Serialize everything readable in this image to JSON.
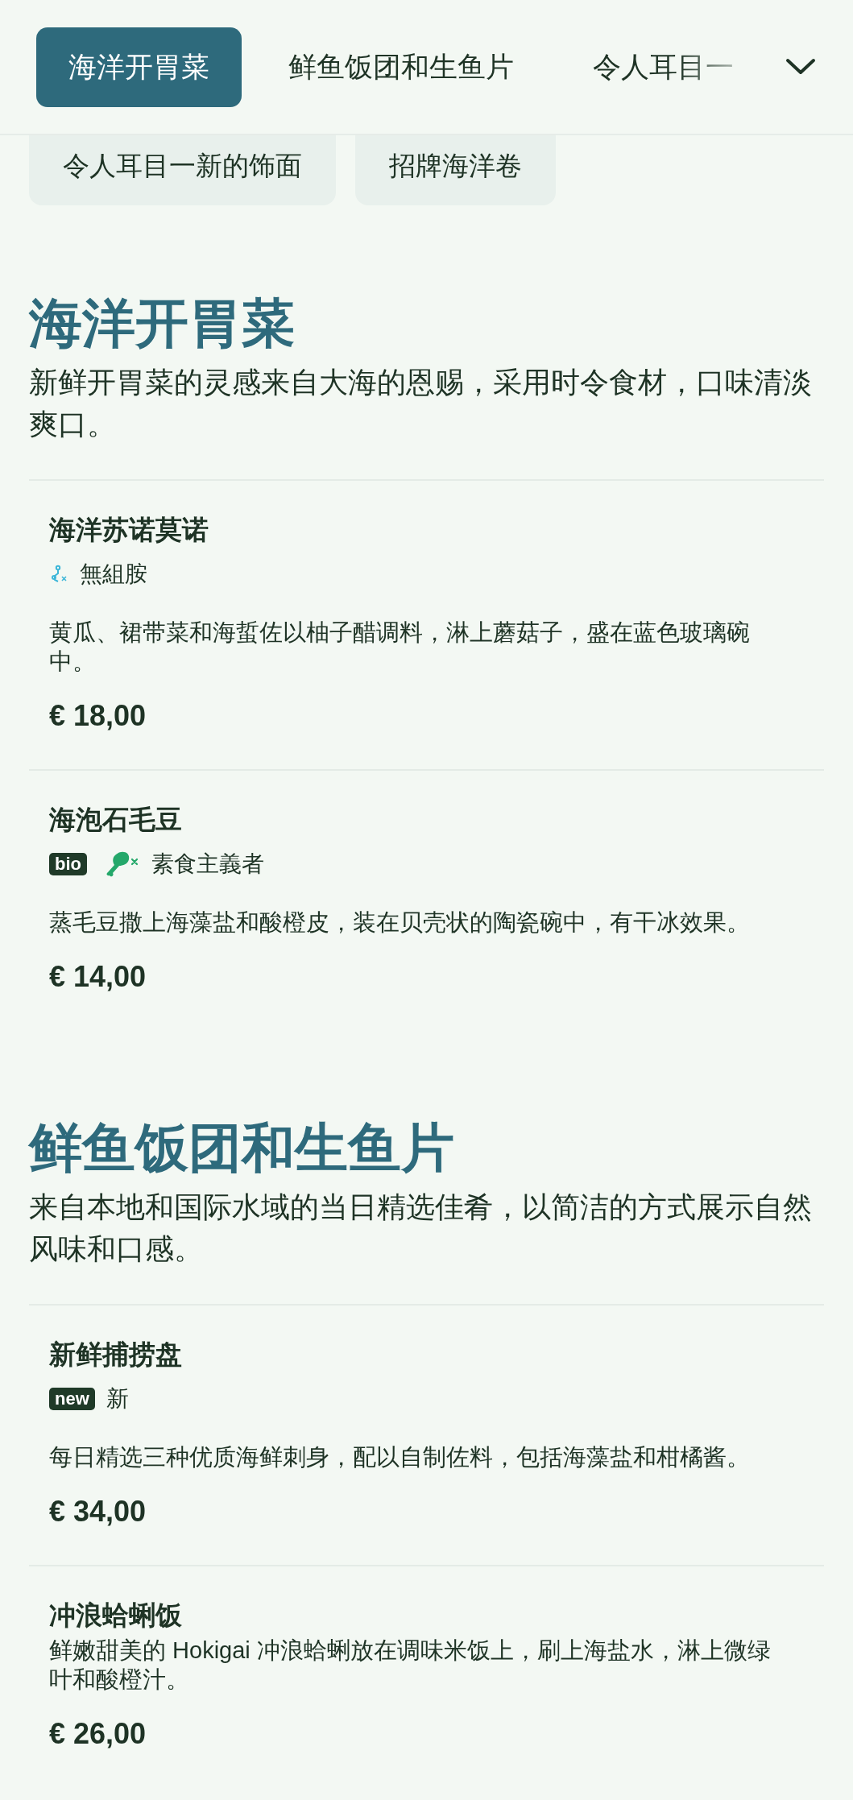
{
  "tabs": [
    {
      "label": "海洋开胃菜",
      "selected": true
    },
    {
      "label": "鲜鱼饭团和生鱼片",
      "selected": false
    },
    {
      "label": "令人耳目一",
      "selected": false
    }
  ],
  "category_chips": [
    "令人耳目一新的饰面",
    "招牌海洋卷"
  ],
  "sections": [
    {
      "title": "海洋开胃菜",
      "description": "新鲜开胃菜的灵感来自大海的恩赐，采用时令食材，口味清淡爽口。",
      "items": [
        {
          "name": "海洋苏诺莫诺",
          "tags": [
            {
              "kind": "histamine-free",
              "label": "無組胺"
            }
          ],
          "description": "黄瓜、裙带菜和海蜇佐以柚子醋调料，淋上蘑菇子，盛在蓝色玻璃碗中。",
          "price": "€ 18,00"
        },
        {
          "name": "海泡石毛豆",
          "tags": [
            {
              "kind": "badge",
              "label": "bio"
            },
            {
              "kind": "vegan",
              "label": "素食主義者"
            }
          ],
          "description": "蒸毛豆撒上海藻盐和酸橙皮，装在贝壳状的陶瓷碗中，有干冰效果。",
          "price": "€ 14,00"
        }
      ]
    },
    {
      "title": "鲜鱼饭团和生鱼片",
      "description": "来自本地和国际水域的当日精选佳肴，以简洁的方式展示自然风味和口感。",
      "items": [
        {
          "name": "新鲜捕捞盘",
          "tags": [
            {
              "kind": "badge",
              "label": "new"
            },
            {
              "kind": "text",
              "label": "新"
            }
          ],
          "description": "每日精选三种优质海鲜刺身，配以自制佐料，包括海藻盐和柑橘酱。",
          "price": "€ 34,00"
        },
        {
          "name": "冲浪蛤蜊饭",
          "description": "鲜嫩甜美的 Hokigai 冲浪蛤蜊放在调味米饭上，刷上海盐水，淋上微绿叶和酸橙汁。",
          "price": "€ 26,00"
        }
      ]
    }
  ]
}
